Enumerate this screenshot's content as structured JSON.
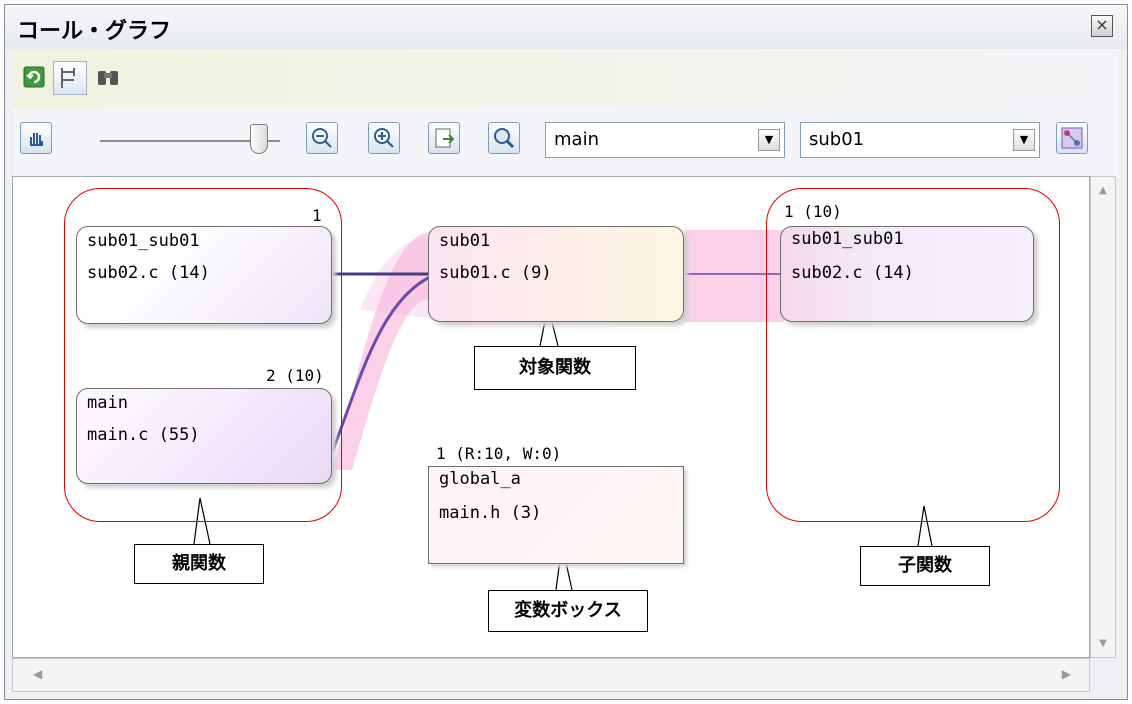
{
  "window": {
    "title": "コール・グラフ",
    "close_icon": "close-icon"
  },
  "toolbar1": {
    "icons": [
      "refresh-icon",
      "tree-icon",
      "binoculars-icon"
    ]
  },
  "toolbar2": {
    "icons": [
      "hand-icon",
      "zoom-out-icon",
      "zoom-in-icon",
      "fit-icon",
      "search-icon",
      "layout-icon"
    ],
    "combo_left": "main",
    "combo_right": "sub01"
  },
  "nodes": {
    "parent1": {
      "count": "1",
      "line1": "sub01_sub01",
      "line2": "sub02.c (14)"
    },
    "parent2": {
      "count": "2 (10)",
      "line1": "main",
      "line2": "main.c (55)"
    },
    "target": {
      "line1": "sub01",
      "line2": "sub01.c (9)"
    },
    "child1": {
      "count": "1 (10)",
      "line1": "sub01_sub01",
      "line2": "sub02.c (14)"
    },
    "variable": {
      "count": "1 (R:10, W:0)",
      "line1": "global_a",
      "line2": "main.h (3)"
    }
  },
  "callouts": {
    "target": "対象関数",
    "parent": "親関数",
    "variable": "変数ボックス",
    "child": "子関数"
  },
  "colors": {
    "highlight": "#f7b8dc",
    "edge": "#5a3f9a",
    "annotation": "#e00000"
  }
}
